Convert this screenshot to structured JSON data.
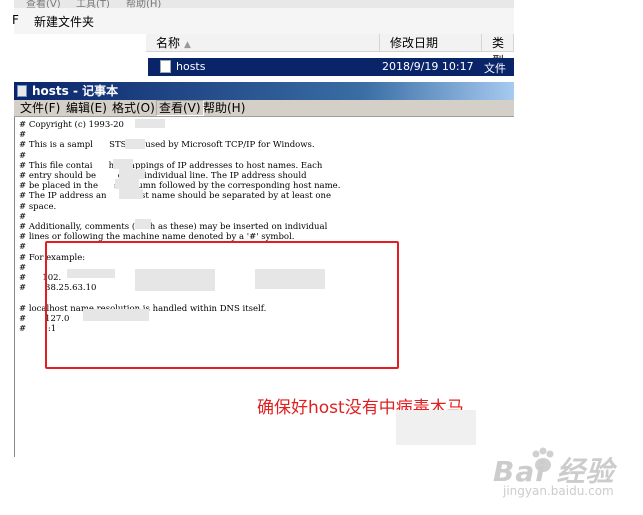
{
  "explorer": {
    "menu": [
      "查看(V)",
      "工具(T)",
      "帮助(H)"
    ],
    "toolbar_left": "F",
    "new_folder": "新建文件夹",
    "columns": {
      "name": "名称",
      "modified": "修改日期",
      "type": "类型"
    },
    "file": {
      "name": "hosts",
      "modified": "2018/9/19 10:17",
      "type": "文件"
    }
  },
  "notepad": {
    "title": "hosts - 记事本",
    "menu": [
      "文件(F)",
      "编辑(E)",
      "格式(O)",
      "查看(V)",
      "帮助(H)"
    ],
    "lines": [
      "# Copyright (c) 1993-20",
      "#",
      "# This is a sampl      STS file used by Microsoft TCP/IP for Windows.",
      "#",
      "# This file contai      he mappings of IP addresses to host names. Each",
      "# entry should be        on an individual line. The IP address should",
      "# be placed in the      st column followed by the corresponding host name.",
      "# The IP address an      e host name should be separated by at least one",
      "# space.",
      "#",
      "# Additionally, comments (such as these) may be inserted on individual",
      "# lines or following the machine name denoted by a '#' symbol.",
      "#",
      "# For example:",
      "#",
      "#      102.",
      "#       38.25.63.10",
      "",
      "# localhost name resolution is handled within DNS itself.",
      "#       127.0               calhost",
      "#       ::1"
    ]
  },
  "annotation": "确保好host没有中病毒木马",
  "watermark": {
    "main": "Bai  经验",
    "sub": "jingyan.baidu.com"
  }
}
